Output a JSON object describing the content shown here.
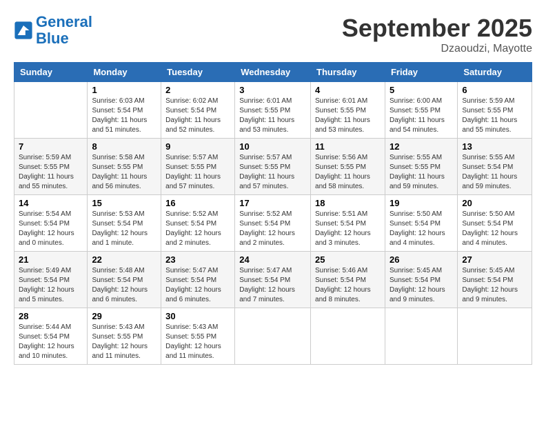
{
  "logo": {
    "line1": "General",
    "line2": "Blue"
  },
  "title": "September 2025",
  "subtitle": "Dzaoudzi, Mayotte",
  "days_of_week": [
    "Sunday",
    "Monday",
    "Tuesday",
    "Wednesday",
    "Thursday",
    "Friday",
    "Saturday"
  ],
  "weeks": [
    [
      {
        "day": "",
        "sunrise": "",
        "sunset": "",
        "daylight": ""
      },
      {
        "day": "1",
        "sunrise": "Sunrise: 6:03 AM",
        "sunset": "Sunset: 5:54 PM",
        "daylight": "Daylight: 11 hours and 51 minutes."
      },
      {
        "day": "2",
        "sunrise": "Sunrise: 6:02 AM",
        "sunset": "Sunset: 5:54 PM",
        "daylight": "Daylight: 11 hours and 52 minutes."
      },
      {
        "day": "3",
        "sunrise": "Sunrise: 6:01 AM",
        "sunset": "Sunset: 5:55 PM",
        "daylight": "Daylight: 11 hours and 53 minutes."
      },
      {
        "day": "4",
        "sunrise": "Sunrise: 6:01 AM",
        "sunset": "Sunset: 5:55 PM",
        "daylight": "Daylight: 11 hours and 53 minutes."
      },
      {
        "day": "5",
        "sunrise": "Sunrise: 6:00 AM",
        "sunset": "Sunset: 5:55 PM",
        "daylight": "Daylight: 11 hours and 54 minutes."
      },
      {
        "day": "6",
        "sunrise": "Sunrise: 5:59 AM",
        "sunset": "Sunset: 5:55 PM",
        "daylight": "Daylight: 11 hours and 55 minutes."
      }
    ],
    [
      {
        "day": "7",
        "sunrise": "Sunrise: 5:59 AM",
        "sunset": "Sunset: 5:55 PM",
        "daylight": "Daylight: 11 hours and 55 minutes."
      },
      {
        "day": "8",
        "sunrise": "Sunrise: 5:58 AM",
        "sunset": "Sunset: 5:55 PM",
        "daylight": "Daylight: 11 hours and 56 minutes."
      },
      {
        "day": "9",
        "sunrise": "Sunrise: 5:57 AM",
        "sunset": "Sunset: 5:55 PM",
        "daylight": "Daylight: 11 hours and 57 minutes."
      },
      {
        "day": "10",
        "sunrise": "Sunrise: 5:57 AM",
        "sunset": "Sunset: 5:55 PM",
        "daylight": "Daylight: 11 hours and 57 minutes."
      },
      {
        "day": "11",
        "sunrise": "Sunrise: 5:56 AM",
        "sunset": "Sunset: 5:55 PM",
        "daylight": "Daylight: 11 hours and 58 minutes."
      },
      {
        "day": "12",
        "sunrise": "Sunrise: 5:55 AM",
        "sunset": "Sunset: 5:55 PM",
        "daylight": "Daylight: 11 hours and 59 minutes."
      },
      {
        "day": "13",
        "sunrise": "Sunrise: 5:55 AM",
        "sunset": "Sunset: 5:54 PM",
        "daylight": "Daylight: 11 hours and 59 minutes."
      }
    ],
    [
      {
        "day": "14",
        "sunrise": "Sunrise: 5:54 AM",
        "sunset": "Sunset: 5:54 PM",
        "daylight": "Daylight: 12 hours and 0 minutes."
      },
      {
        "day": "15",
        "sunrise": "Sunrise: 5:53 AM",
        "sunset": "Sunset: 5:54 PM",
        "daylight": "Daylight: 12 hours and 1 minute."
      },
      {
        "day": "16",
        "sunrise": "Sunrise: 5:52 AM",
        "sunset": "Sunset: 5:54 PM",
        "daylight": "Daylight: 12 hours and 2 minutes."
      },
      {
        "day": "17",
        "sunrise": "Sunrise: 5:52 AM",
        "sunset": "Sunset: 5:54 PM",
        "daylight": "Daylight: 12 hours and 2 minutes."
      },
      {
        "day": "18",
        "sunrise": "Sunrise: 5:51 AM",
        "sunset": "Sunset: 5:54 PM",
        "daylight": "Daylight: 12 hours and 3 minutes."
      },
      {
        "day": "19",
        "sunrise": "Sunrise: 5:50 AM",
        "sunset": "Sunset: 5:54 PM",
        "daylight": "Daylight: 12 hours and 4 minutes."
      },
      {
        "day": "20",
        "sunrise": "Sunrise: 5:50 AM",
        "sunset": "Sunset: 5:54 PM",
        "daylight": "Daylight: 12 hours and 4 minutes."
      }
    ],
    [
      {
        "day": "21",
        "sunrise": "Sunrise: 5:49 AM",
        "sunset": "Sunset: 5:54 PM",
        "daylight": "Daylight: 12 hours and 5 minutes."
      },
      {
        "day": "22",
        "sunrise": "Sunrise: 5:48 AM",
        "sunset": "Sunset: 5:54 PM",
        "daylight": "Daylight: 12 hours and 6 minutes."
      },
      {
        "day": "23",
        "sunrise": "Sunrise: 5:47 AM",
        "sunset": "Sunset: 5:54 PM",
        "daylight": "Daylight: 12 hours and 6 minutes."
      },
      {
        "day": "24",
        "sunrise": "Sunrise: 5:47 AM",
        "sunset": "Sunset: 5:54 PM",
        "daylight": "Daylight: 12 hours and 7 minutes."
      },
      {
        "day": "25",
        "sunrise": "Sunrise: 5:46 AM",
        "sunset": "Sunset: 5:54 PM",
        "daylight": "Daylight: 12 hours and 8 minutes."
      },
      {
        "day": "26",
        "sunrise": "Sunrise: 5:45 AM",
        "sunset": "Sunset: 5:54 PM",
        "daylight": "Daylight: 12 hours and 9 minutes."
      },
      {
        "day": "27",
        "sunrise": "Sunrise: 5:45 AM",
        "sunset": "Sunset: 5:54 PM",
        "daylight": "Daylight: 12 hours and 9 minutes."
      }
    ],
    [
      {
        "day": "28",
        "sunrise": "Sunrise: 5:44 AM",
        "sunset": "Sunset: 5:54 PM",
        "daylight": "Daylight: 12 hours and 10 minutes."
      },
      {
        "day": "29",
        "sunrise": "Sunrise: 5:43 AM",
        "sunset": "Sunset: 5:55 PM",
        "daylight": "Daylight: 12 hours and 11 minutes."
      },
      {
        "day": "30",
        "sunrise": "Sunrise: 5:43 AM",
        "sunset": "Sunset: 5:55 PM",
        "daylight": "Daylight: 12 hours and 11 minutes."
      },
      {
        "day": "",
        "sunrise": "",
        "sunset": "",
        "daylight": ""
      },
      {
        "day": "",
        "sunrise": "",
        "sunset": "",
        "daylight": ""
      },
      {
        "day": "",
        "sunrise": "",
        "sunset": "",
        "daylight": ""
      },
      {
        "day": "",
        "sunrise": "",
        "sunset": "",
        "daylight": ""
      }
    ]
  ]
}
